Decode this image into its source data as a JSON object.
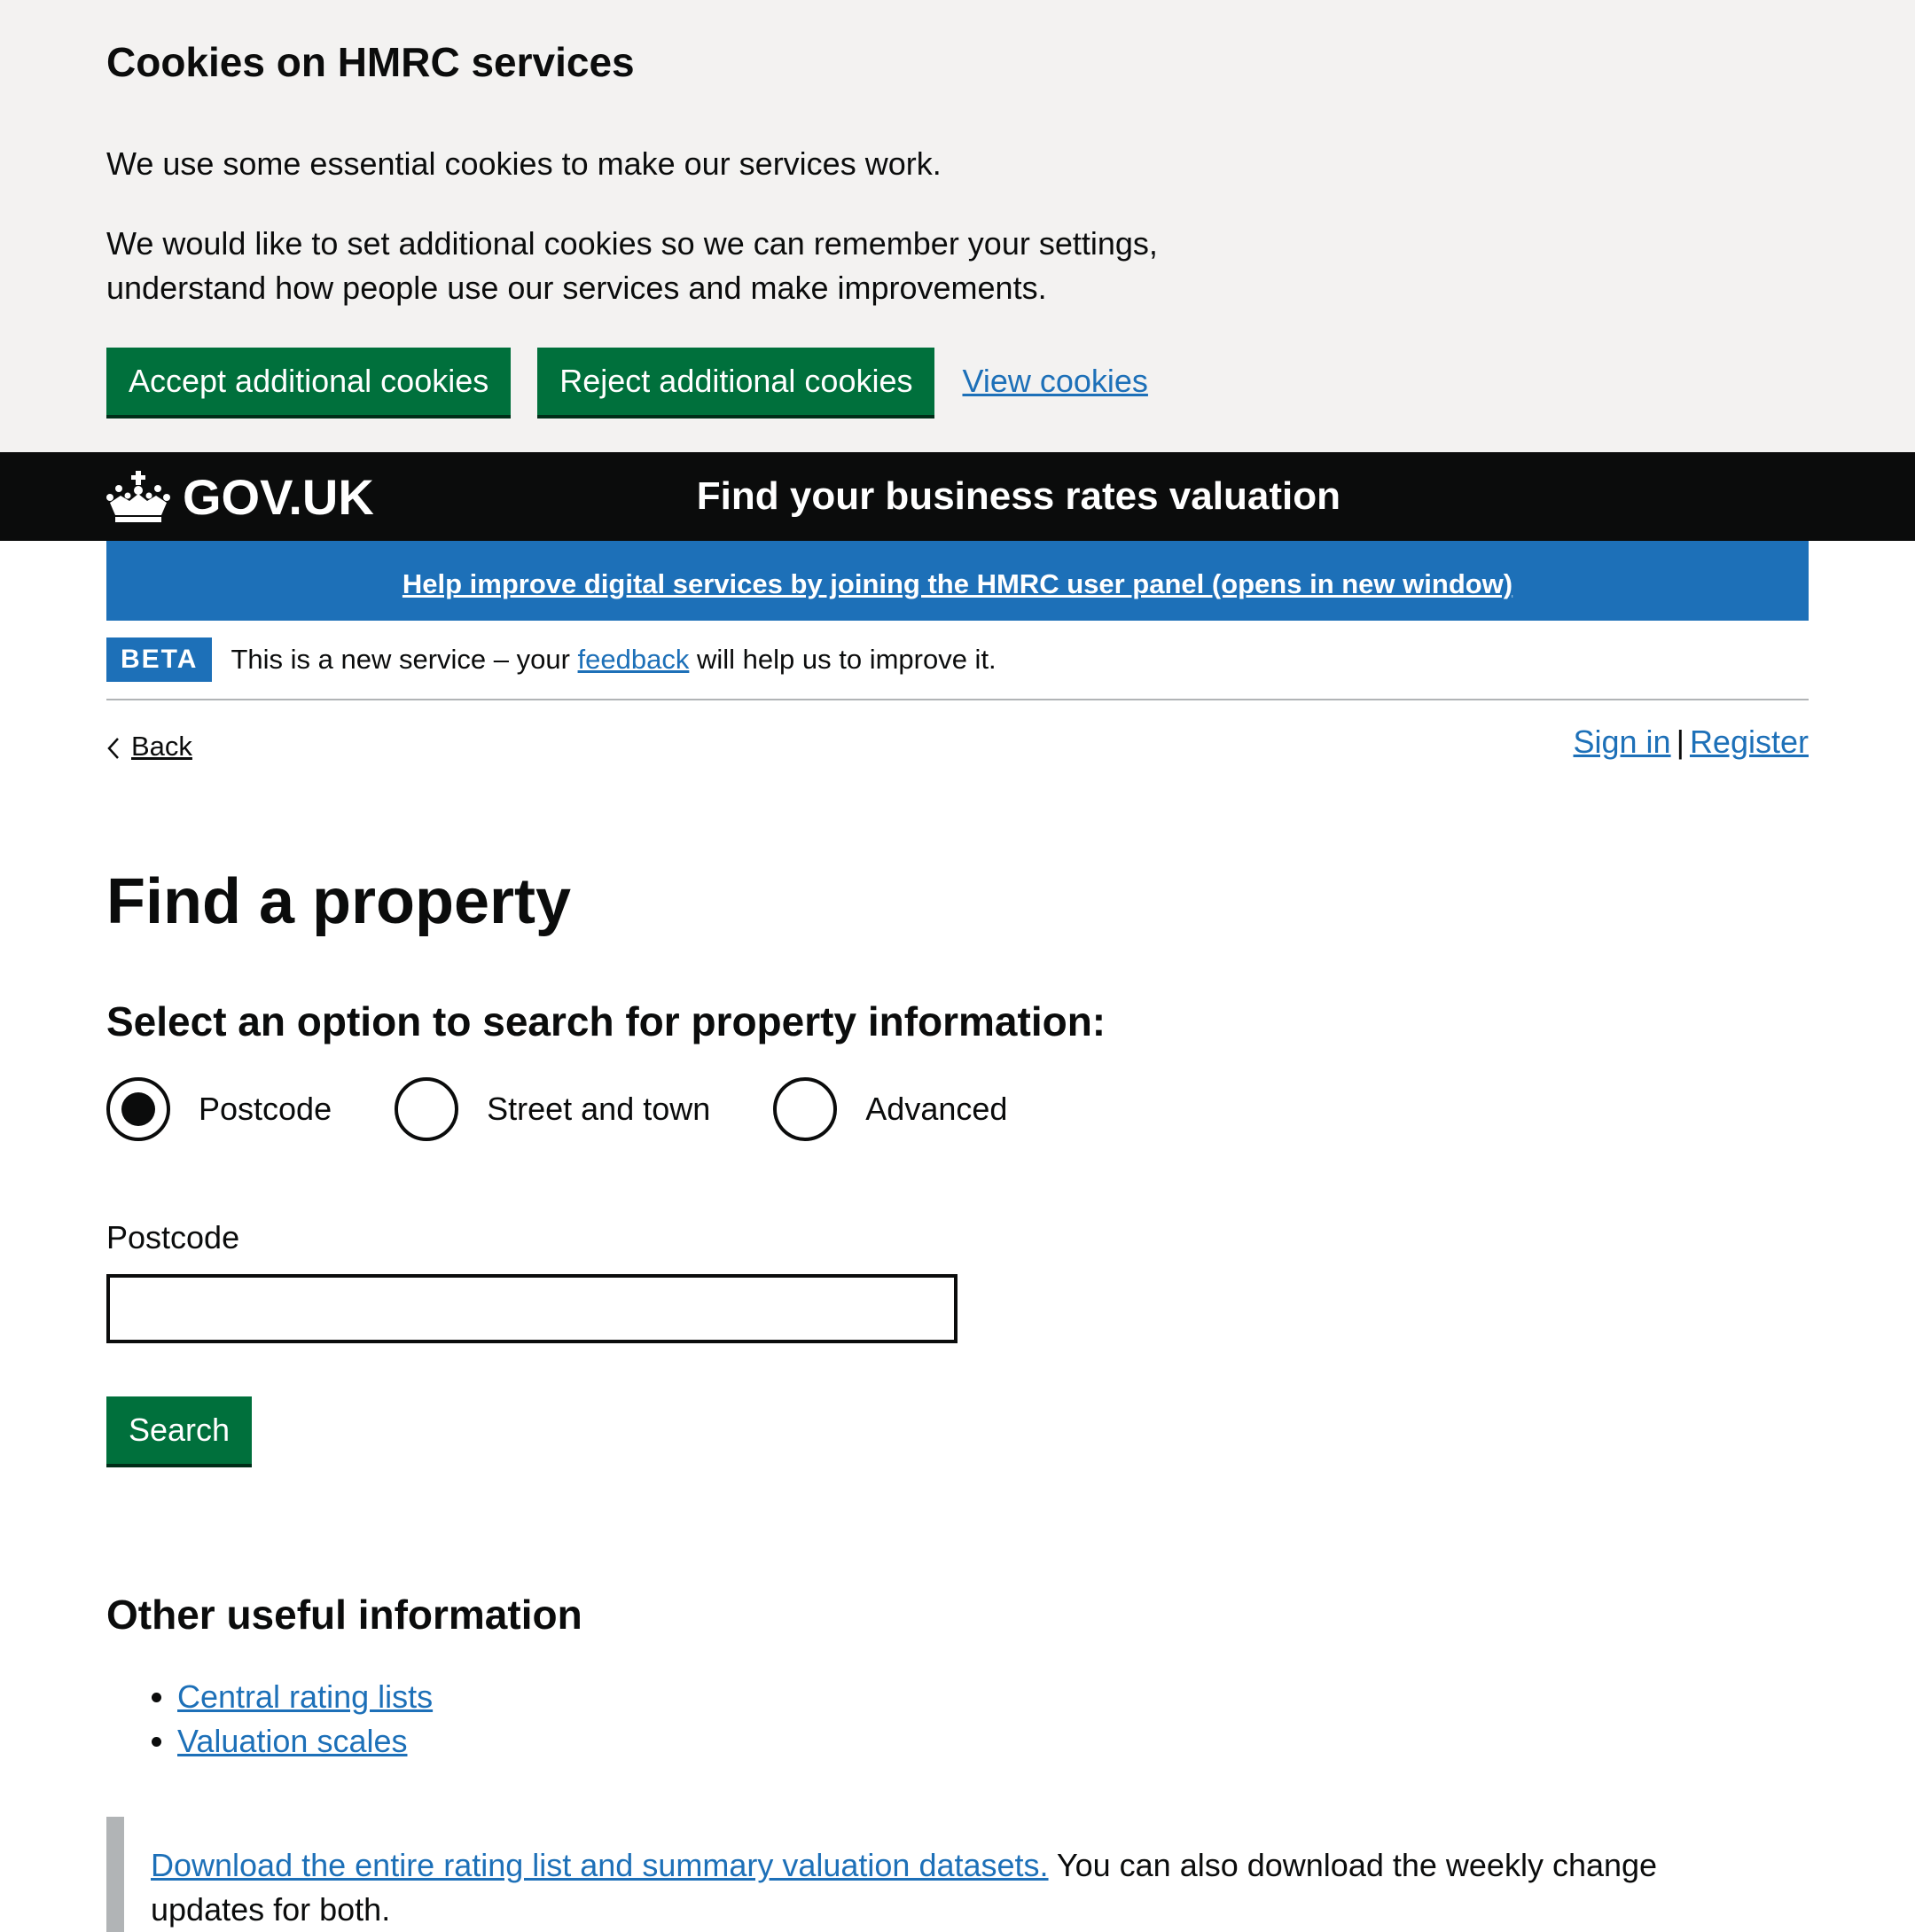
{
  "cookie_banner": {
    "title": "Cookies on HMRC services",
    "p1": "We use some essential cookies to make our services work.",
    "p2": "We would like to set additional cookies so we can remember your settings, understand how people use our services and make improvements.",
    "accept_label": "Accept additional cookies",
    "reject_label": "Reject additional cookies",
    "view_label": "View cookies"
  },
  "header": {
    "logo_text": "GOV.UK",
    "service_name": "Find your business rates valuation"
  },
  "panel_banner": {
    "link_text": "Help improve digital services by joining the HMRC user panel (opens in new window)"
  },
  "phase_banner": {
    "tag": "BETA",
    "text_before": "This is a new service – your ",
    "link": "feedback",
    "text_after": " will help us to improve it."
  },
  "nav": {
    "back": "Back",
    "sign_in": "Sign in",
    "separator": "|",
    "register": "Register"
  },
  "main": {
    "title": "Find a property",
    "legend": "Select an option to search for property information:",
    "options": [
      {
        "label": "Postcode",
        "checked": true
      },
      {
        "label": "Street and town",
        "checked": false
      },
      {
        "label": "Advanced",
        "checked": false
      }
    ],
    "field_label": "Postcode",
    "field_value": "",
    "search_label": "Search"
  },
  "other_info": {
    "title": "Other useful information",
    "links": [
      "Central rating lists",
      "Valuation scales"
    ]
  },
  "inset": {
    "link": "Download the entire rating list and summary valuation datasets.",
    "text": " You can also download the weekly change updates for both."
  },
  "colors": {
    "button_green": "#00703c",
    "link_blue": "#1d70b8",
    "header_black": "#0b0c0c",
    "banner_grey": "#f3f2f1"
  }
}
